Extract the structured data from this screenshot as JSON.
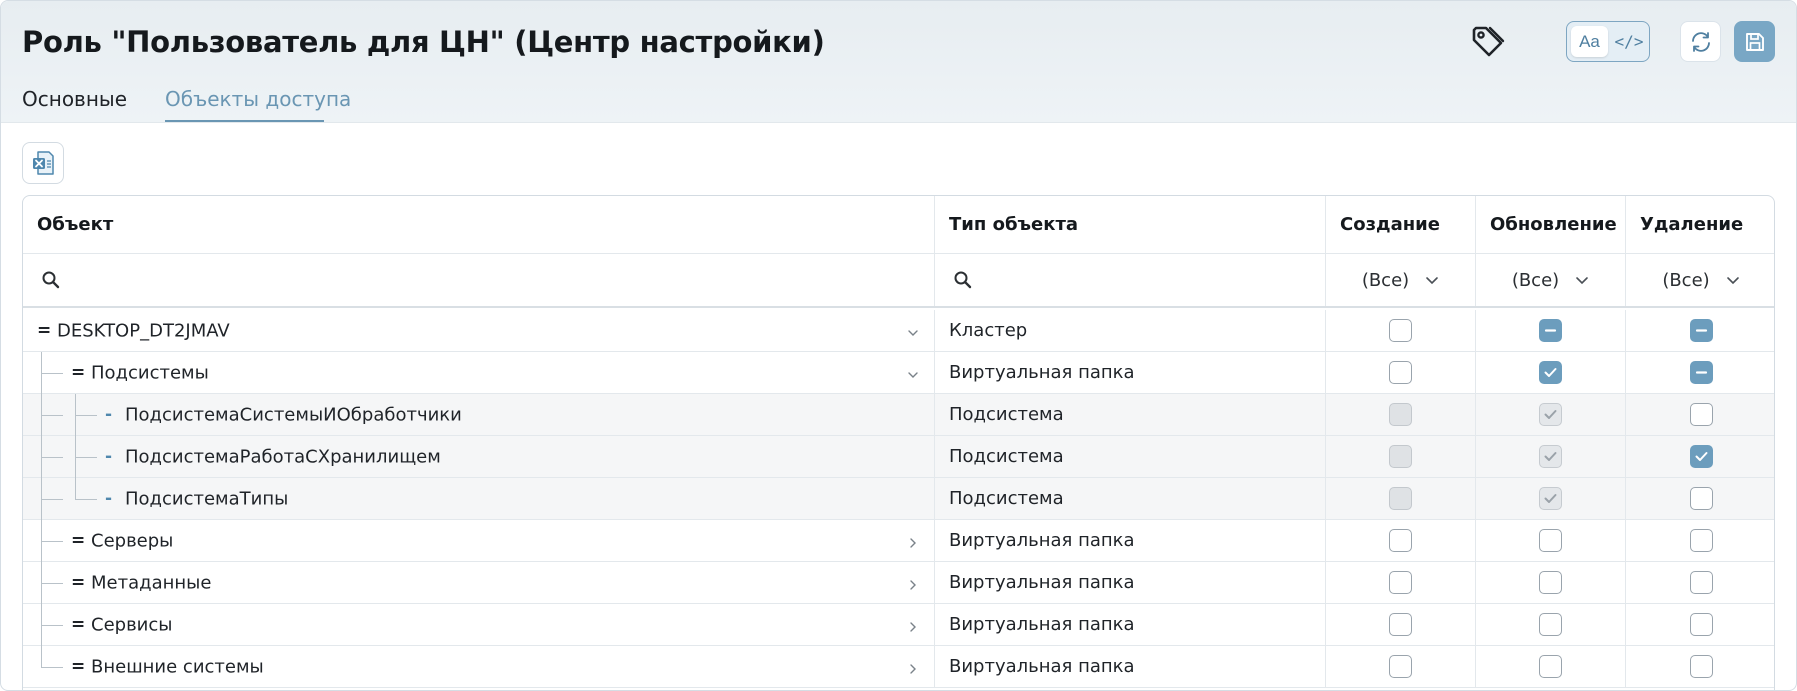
{
  "header": {
    "title": "Роль \"Пользователь для ЦН\" (Центр настройки)",
    "tabs": [
      {
        "label": "Основные",
        "active": false
      },
      {
        "label": "Объекты доступа",
        "active": true
      }
    ],
    "view_toggle": {
      "text_label": "Aa",
      "code_label": "</>",
      "selected": "Aa"
    },
    "icons": {
      "tag": "tag-icon",
      "refresh": "refresh-icon",
      "save": "save-icon"
    }
  },
  "toolbar": {
    "export_icon": "excel-export-icon"
  },
  "grid": {
    "columns": [
      "Объект",
      "Тип объекта",
      "Создание",
      "Обновление",
      "Удаление"
    ],
    "filters": {
      "create": "(Все)",
      "update": "(Все)",
      "delete": "(Все)"
    },
    "rows": [
      {
        "name": "DESKTOP_DT2JMAV",
        "type": "Кластер",
        "level": 0,
        "marker": "=",
        "expander": "down",
        "create": "unchecked",
        "update": "indeterminate",
        "delete": "indeterminate"
      },
      {
        "name": "Подсистемы",
        "type": "Виртуальная папка",
        "level": 1,
        "marker": "=",
        "expander": "down",
        "create": "unchecked",
        "update": "checked",
        "delete": "indeterminate"
      },
      {
        "name": "ПодсистемаСистемыИОбработчики",
        "type": "Подсистема",
        "level": 2,
        "marker": "-",
        "expander": "",
        "create": "disabled",
        "update": "disabled-checked",
        "delete": "unchecked"
      },
      {
        "name": "ПодсистемаРаботаСХранилищем",
        "type": "Подсистема",
        "level": 2,
        "marker": "-",
        "expander": "",
        "create": "disabled",
        "update": "disabled-checked",
        "delete": "checked"
      },
      {
        "name": "ПодсистемаТипы",
        "type": "Подсистема",
        "level": 2,
        "marker": "-",
        "expander": "",
        "create": "disabled",
        "update": "disabled-checked",
        "delete": "unchecked"
      },
      {
        "name": "Серверы",
        "type": "Виртуальная папка",
        "level": 1,
        "marker": "=",
        "expander": "right",
        "create": "unchecked",
        "update": "unchecked",
        "delete": "unchecked"
      },
      {
        "name": "Метаданные",
        "type": "Виртуальная папка",
        "level": 1,
        "marker": "=",
        "expander": "right",
        "create": "unchecked",
        "update": "unchecked",
        "delete": "unchecked"
      },
      {
        "name": "Сервисы",
        "type": "Виртуальная папка",
        "level": 1,
        "marker": "=",
        "expander": "right",
        "create": "unchecked",
        "update": "unchecked",
        "delete": "unchecked"
      },
      {
        "name": "Внешние системы",
        "type": "Виртуальная папка",
        "level": 1,
        "marker": "=",
        "expander": "right",
        "create": "unchecked",
        "update": "unchecked",
        "delete": "unchecked"
      }
    ]
  },
  "colors": {
    "accent": "#6c9dbd",
    "tab_active": "#6a96b3",
    "save_button": "#79a7c5"
  }
}
